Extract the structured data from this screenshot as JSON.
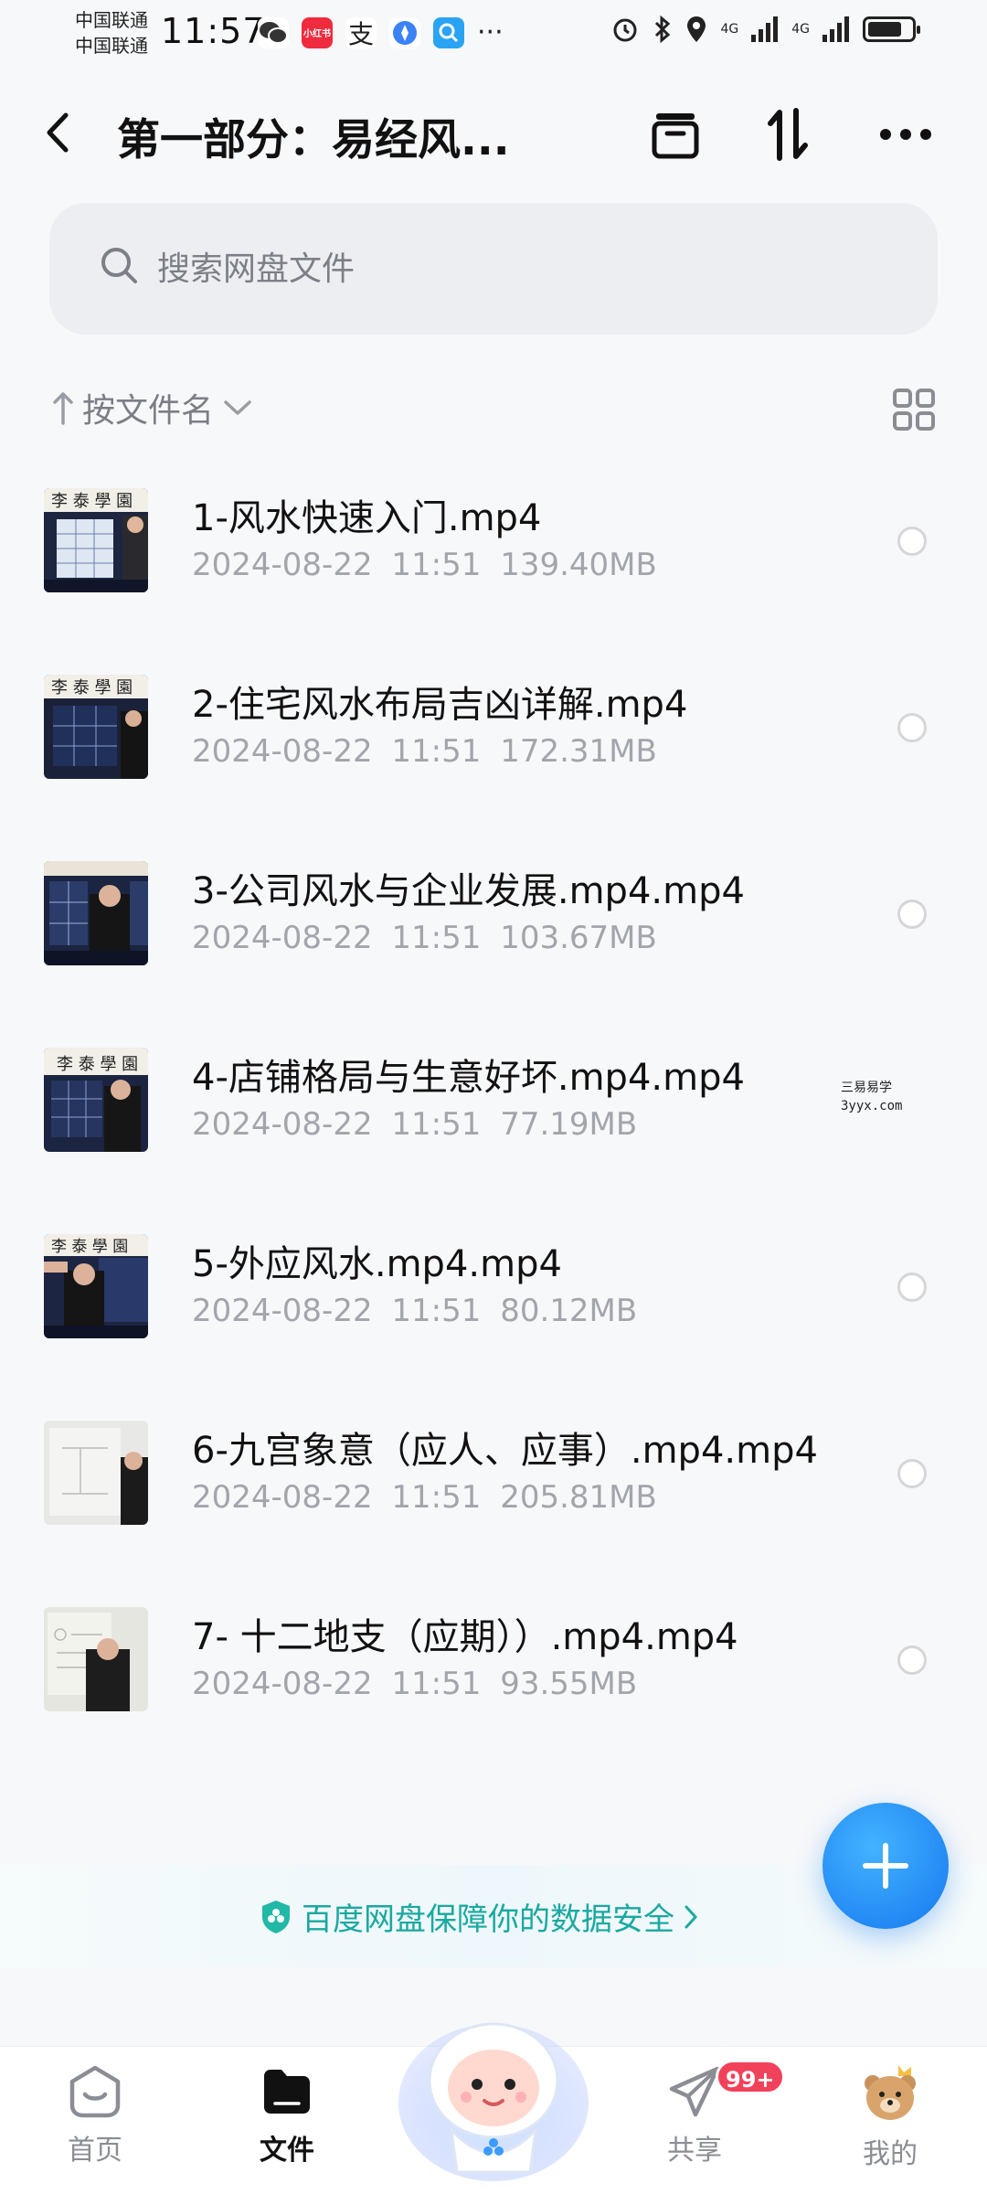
{
  "status_bar": {
    "carrier_1": "中国联通",
    "carrier_2": "中国联通",
    "time": "11:57",
    "app_badge": "小红书",
    "alipay_char": "支",
    "network_1": "4G",
    "network_2": "4G"
  },
  "header": {
    "title": "第一部分：易经风..."
  },
  "search": {
    "placeholder": "搜索网盘文件"
  },
  "sort": {
    "label": "按文件名"
  },
  "files": [
    {
      "name": "1-风水快速入门.mp4",
      "date": "2024-08-22",
      "time": "11:51",
      "size": "139.40MB"
    },
    {
      "name": "2-住宅风水布局吉凶详解.mp4",
      "date": "2024-08-22",
      "time": "11:51",
      "size": "172.31MB"
    },
    {
      "name": "3-公司风水与企业发展.mp4.mp4",
      "date": "2024-08-22",
      "time": "11:51",
      "size": "103.67MB"
    },
    {
      "name": "4-店铺格局与生意好坏.mp4.mp4",
      "date": "2024-08-22",
      "time": "11:51",
      "size": "77.19MB"
    },
    {
      "name": "5-外应风水.mp4.mp4",
      "date": "2024-08-22",
      "time": "11:51",
      "size": "80.12MB"
    },
    {
      "name": "6-九宫象意（应人、应事）.mp4.mp4",
      "date": "2024-08-22",
      "time": "11:51",
      "size": "205.81MB"
    },
    {
      "name": "7- 十二地支（应期））.mp4.mp4",
      "date": "2024-08-22",
      "time": "11:51",
      "size": "93.55MB"
    }
  ],
  "watermark": {
    "line1": "三易易学",
    "line2": "3yyx.com"
  },
  "banner": {
    "text": "百度网盘保障你的数据安全"
  },
  "nav": {
    "home": "首页",
    "files": "文件",
    "share": "共享",
    "share_badge": "99+",
    "mine": "我的"
  },
  "colors": {
    "accent": "#1678f0",
    "banner_text": "#1aa9a0",
    "badge": "#f2415a"
  }
}
